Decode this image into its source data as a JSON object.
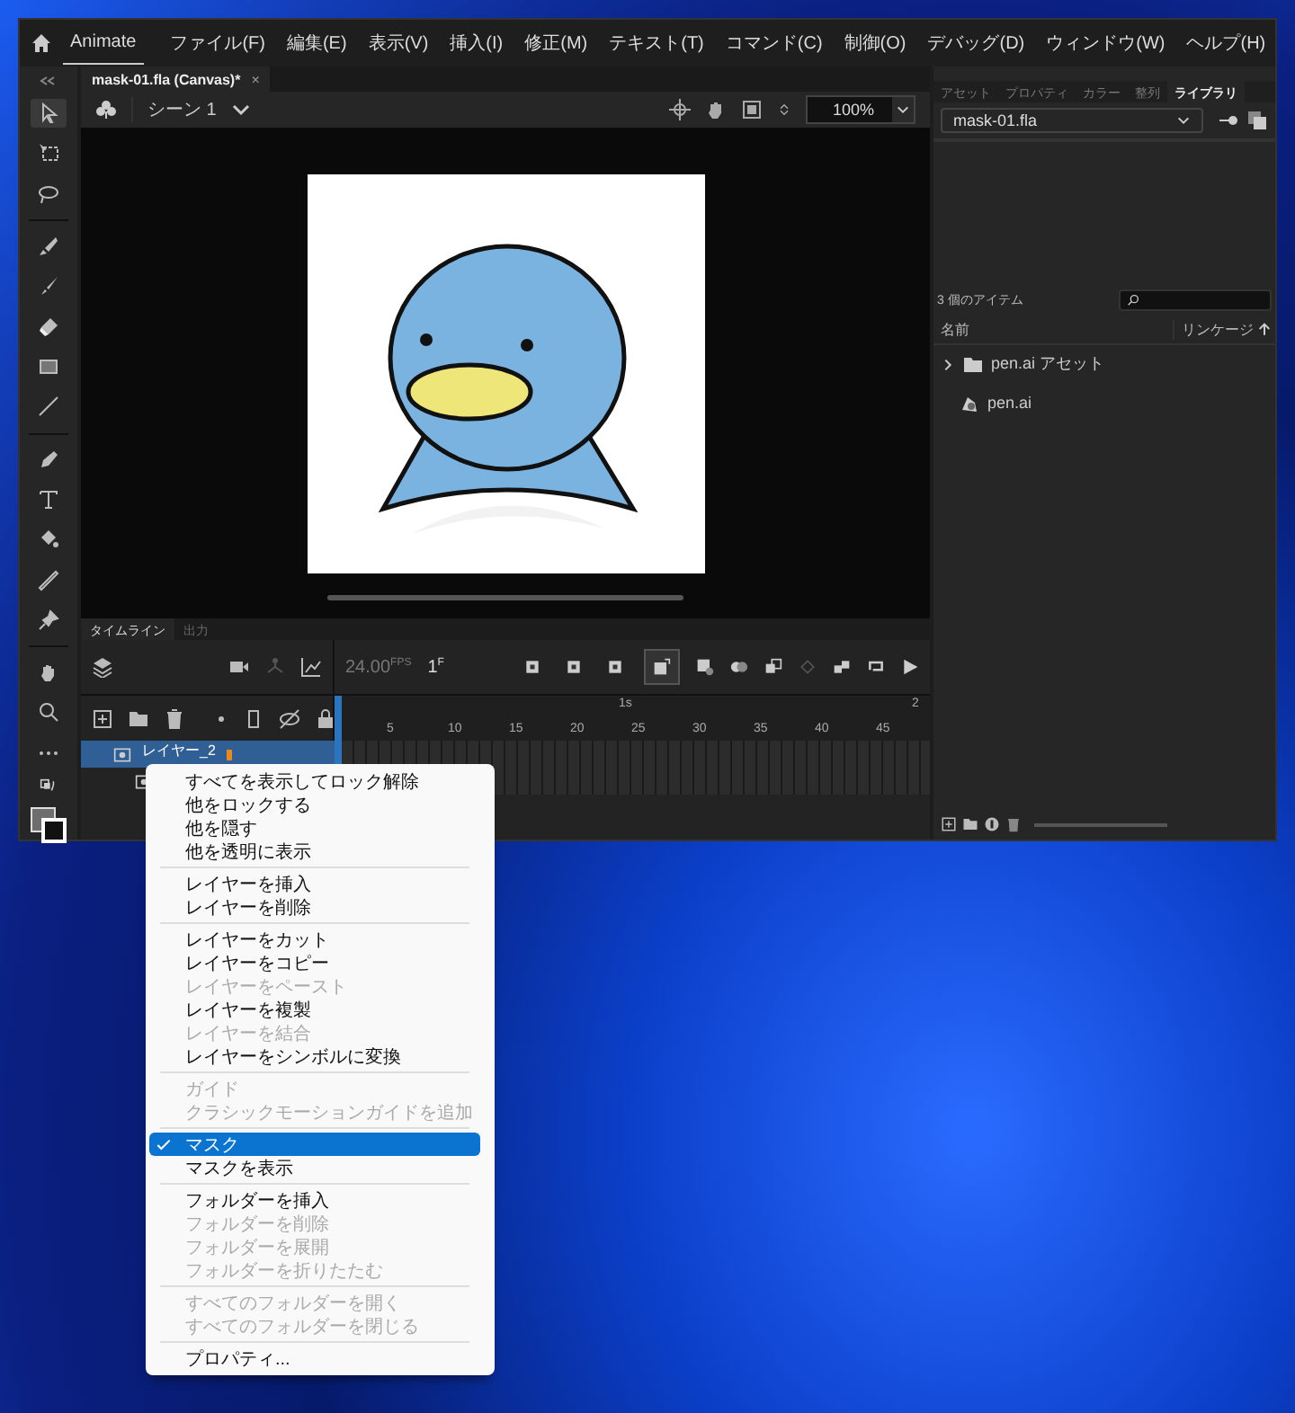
{
  "app": {
    "name": "Animate"
  },
  "menu": [
    {
      "label": "ファイル(F)"
    },
    {
      "label": "編集(E)"
    },
    {
      "label": "表示(V)"
    },
    {
      "label": "挿入(I)"
    },
    {
      "label": "修正(M)"
    },
    {
      "label": "テキスト(T)"
    },
    {
      "label": "コマンド(C)"
    },
    {
      "label": "制御(O)"
    },
    {
      "label": "デバッグ(D)"
    },
    {
      "label": "ウィンドウ(W)"
    },
    {
      "label": "ヘルプ(H)"
    }
  ],
  "tools": [
    {
      "kind": "select",
      "selected": true
    },
    {
      "kind": "transform",
      "selected": false
    },
    {
      "kind": "lasso",
      "selected": false
    },
    {
      "kind": "sep"
    },
    {
      "kind": "paintbrush",
      "selected": false
    },
    {
      "kind": "brush",
      "selected": false
    },
    {
      "kind": "eraser",
      "selected": false
    },
    {
      "kind": "rect",
      "selected": false
    },
    {
      "kind": "line",
      "selected": false
    },
    {
      "kind": "sep"
    },
    {
      "kind": "pen",
      "selected": false
    },
    {
      "kind": "text",
      "selected": false
    },
    {
      "kind": "bucket",
      "selected": false
    },
    {
      "kind": "eyedropper",
      "selected": false
    },
    {
      "kind": "pin",
      "selected": false
    },
    {
      "kind": "sep"
    },
    {
      "kind": "hand",
      "selected": false
    },
    {
      "kind": "zoom",
      "selected": false
    },
    {
      "kind": "more",
      "selected": false
    }
  ],
  "document_tab": {
    "title": "mask-01.fla (Canvas)*",
    "close": "×"
  },
  "scene": {
    "label": "シーン 1"
  },
  "zoom": {
    "value": "100%"
  },
  "timeline": {
    "tabs": [
      {
        "label": "タイムライン",
        "selected": true
      },
      {
        "label": "出力",
        "selected": false
      }
    ],
    "fps": "24.00",
    "fps_unit": "FPS",
    "frame": "1",
    "frame_unit": "F",
    "seconds": [
      "1s",
      "2"
    ],
    "ruler": [
      "5",
      "10",
      "15",
      "20",
      "25",
      "30",
      "35",
      "40",
      "45"
    ],
    "layers": [
      {
        "name": "レイヤー_2",
        "selected": true
      },
      {
        "selected": false
      }
    ]
  },
  "panel": {
    "tabs": [
      {
        "label": "アセット",
        "selected": false
      },
      {
        "label": "プロパティ",
        "selected": false
      },
      {
        "label": "カラー",
        "selected": false
      },
      {
        "label": "整列",
        "selected": false
      },
      {
        "label": "ライブラリ",
        "selected": true
      }
    ],
    "library": {
      "file": "mask-01.fla",
      "count": "3 個のアイテム",
      "columns": [
        "名前",
        "リンケージ"
      ],
      "items": [
        {
          "name": "pen.ai アセット",
          "kind": "folder",
          "expanded": false
        },
        {
          "name": "pen.ai",
          "kind": "graphic"
        }
      ]
    }
  },
  "context_menu": [
    [
      {
        "label": "すべてを表示してロック解除",
        "disabled": false,
        "checked": false,
        "selected": false
      },
      {
        "label": "他をロックする",
        "disabled": false,
        "checked": false,
        "selected": false
      },
      {
        "label": "他を隠す",
        "disabled": false,
        "checked": false,
        "selected": false
      },
      {
        "label": "他を透明に表示",
        "disabled": false,
        "checked": false,
        "selected": false
      }
    ],
    [
      {
        "label": "レイヤーを挿入",
        "disabled": false,
        "checked": false,
        "selected": false
      },
      {
        "label": "レイヤーを削除",
        "disabled": false,
        "checked": false,
        "selected": false
      }
    ],
    [
      {
        "label": "レイヤーをカット",
        "disabled": false,
        "checked": false,
        "selected": false
      },
      {
        "label": "レイヤーをコピー",
        "disabled": false,
        "checked": false,
        "selected": false
      },
      {
        "label": "レイヤーをペースト",
        "disabled": true,
        "checked": false,
        "selected": false
      },
      {
        "label": "レイヤーを複製",
        "disabled": false,
        "checked": false,
        "selected": false
      },
      {
        "label": "レイヤーを結合",
        "disabled": true,
        "checked": false,
        "selected": false
      },
      {
        "label": "レイヤーをシンボルに変換",
        "disabled": false,
        "checked": false,
        "selected": false
      }
    ],
    [
      {
        "label": "ガイド",
        "disabled": true,
        "checked": false,
        "selected": false
      },
      {
        "label": "クラシックモーションガイドを追加",
        "disabled": true,
        "checked": false,
        "selected": false
      }
    ],
    [
      {
        "label": "マスク",
        "disabled": false,
        "checked": true,
        "selected": true
      },
      {
        "label": "マスクを表示",
        "disabled": false,
        "checked": false,
        "selected": false
      }
    ],
    [
      {
        "label": "フォルダーを挿入",
        "disabled": false,
        "checked": false,
        "selected": false
      },
      {
        "label": "フォルダーを削除",
        "disabled": true,
        "checked": false,
        "selected": false
      },
      {
        "label": "フォルダーを展開",
        "disabled": true,
        "checked": false,
        "selected": false
      },
      {
        "label": "フォルダーを折りたたむ",
        "disabled": true,
        "checked": false,
        "selected": false
      }
    ],
    [
      {
        "label": "すべてのフォルダーを開く",
        "disabled": true,
        "checked": false,
        "selected": false
      },
      {
        "label": "すべてのフォルダーを閉じる",
        "disabled": true,
        "checked": false,
        "selected": false
      }
    ],
    [
      {
        "label": "プロパティ...",
        "disabled": false,
        "checked": false,
        "selected": false
      }
    ]
  ]
}
